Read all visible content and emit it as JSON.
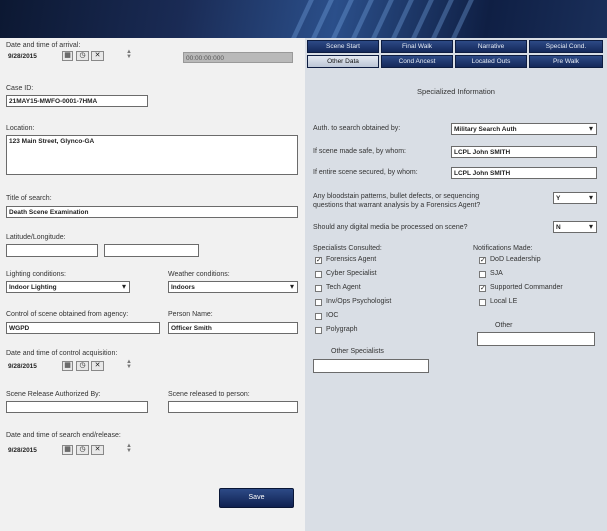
{
  "left_panel": {
    "date_arrival_label": "Date and time of arrival:",
    "date_arrival_value": "9/28/2015",
    "time_display": "00:00:00:000",
    "case_id_label": "Case ID:",
    "case_id_value": "21MAY15-MWFO-0001-7HMA",
    "location_label": "Location:",
    "location_value": "123 Main Street, Glynco-GA",
    "title_label": "Title of search:",
    "title_value": "Death Scene Examination",
    "latlong_label": "Latitude/Longitude:",
    "lighting_label": "Lighting conditions:",
    "lighting_value": "Indoor Lighting",
    "weather_label": "Weather conditions:",
    "weather_value": "Indoors",
    "control_label": "Control of scene obtained from agency:",
    "control_value": "WGPD",
    "person_label": "Person Name:",
    "person_value": "Officer Smith",
    "control_date_label": "Date and time of control acquisition:",
    "control_date_value": "9/28/2015",
    "release_by_label": "Scene Release Authorized By:",
    "release_to_label": "Scene released to person:",
    "search_end_label": "Date and time of search end/release:",
    "search_end_value": "9/28/2015",
    "save_label": "Save"
  },
  "tabs_row1": [
    "Scene Start",
    "Final Walk",
    "Narrative",
    "Special Cond."
  ],
  "tabs_row2": [
    "Other Data",
    "Cond Ancest",
    "Located Outs",
    "Pre Walk"
  ],
  "right_panel": {
    "section_title": "Specialized Information",
    "auth_label": "Auth. to search obtained by:",
    "auth_value": "Military Search Auth",
    "made_safe_label": "If scene made safe, by whom:",
    "made_safe_value": "LCPL John SMITH",
    "secured_label": "If entire scene secured, by whom:",
    "secured_value": "LCPL John SMITH",
    "blood_q_line1": "Any bloodstain patterns, bullet defects, or sequencing",
    "blood_q_line2": "questions that warrant analysis by a Forensics Agent?",
    "blood_value": "Y",
    "digital_q": "Should any digital media be processed on scene?",
    "digital_value": "N",
    "specialists_label": "Specialists Consulted:",
    "specialists": [
      {
        "label": "Forensics Agent",
        "checked": true
      },
      {
        "label": "Cyber Specialist",
        "checked": false
      },
      {
        "label": "Tech Agent",
        "checked": false
      },
      {
        "label": "Inv/Ops Psychologist",
        "checked": false
      },
      {
        "label": "IOC",
        "checked": false
      },
      {
        "label": "Polygraph",
        "checked": false
      }
    ],
    "other_specialists_label": "Other Specialists",
    "notifications_label": "Notifications Made:",
    "notifications": [
      {
        "label": "DoD Leadership",
        "checked": true
      },
      {
        "label": "SJA",
        "checked": false
      },
      {
        "label": "Supported Commander",
        "checked": true
      },
      {
        "label": "Local LE",
        "checked": false
      }
    ],
    "other_label": "Other"
  },
  "colors": {
    "tab_blue": "#1f3a72",
    "button_blue": "#15295c",
    "banner": "#14264f"
  }
}
